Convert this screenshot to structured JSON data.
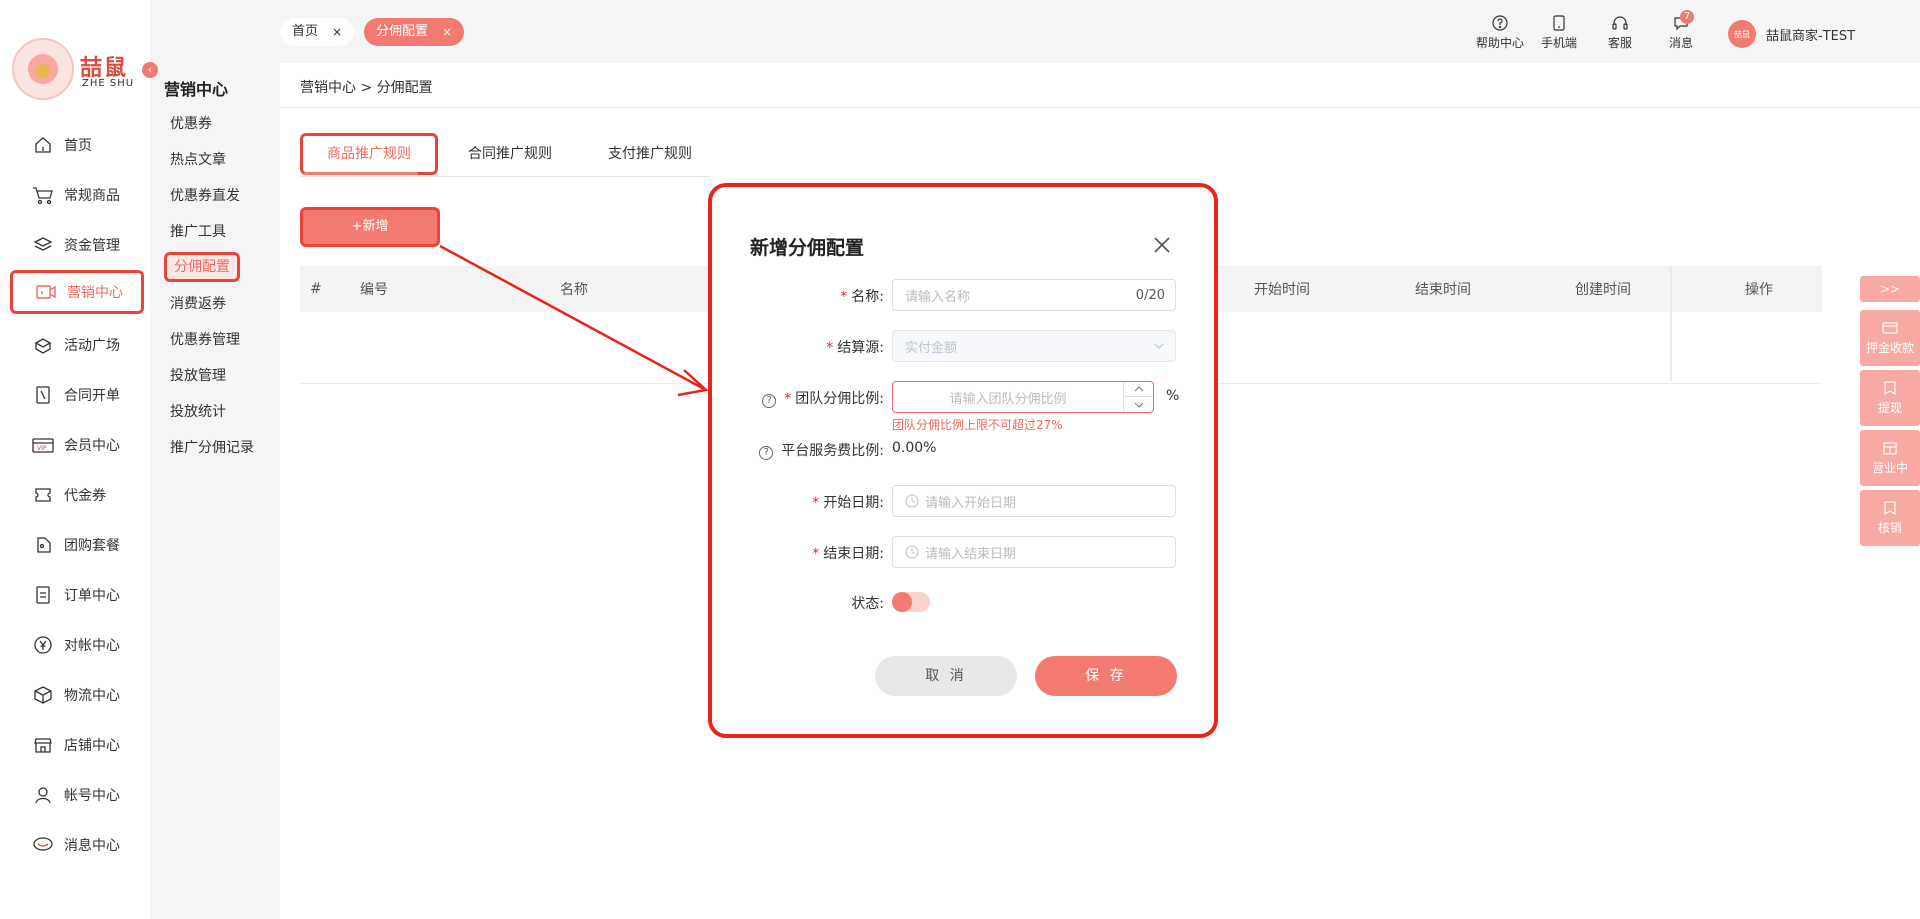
{
  "logo": {
    "brand_cn": "喆鼠",
    "brand_en": "ZHE SHU"
  },
  "collapse_icon": "‹",
  "nav": [
    {
      "label": "首页",
      "icon": "home-icon"
    },
    {
      "label": "常规商品",
      "icon": "cart-icon"
    },
    {
      "label": "资金管理",
      "icon": "layers-icon"
    },
    {
      "label": "营销中心",
      "icon": "marketing-icon",
      "active": true
    },
    {
      "label": "活动广场",
      "icon": "activity-icon"
    },
    {
      "label": "合同开单",
      "icon": "contract-icon"
    },
    {
      "label": "会员中心",
      "icon": "vip-icon"
    },
    {
      "label": "代金券",
      "icon": "voucher-icon"
    },
    {
      "label": "团购套餐",
      "icon": "groupbuy-icon"
    },
    {
      "label": "订单中心",
      "icon": "order-icon"
    },
    {
      "label": "对帐中心",
      "icon": "yen-icon"
    },
    {
      "label": "物流中心",
      "icon": "box-icon"
    },
    {
      "label": "店铺中心",
      "icon": "store-icon"
    },
    {
      "label": "帐号中心",
      "icon": "user-icon"
    },
    {
      "label": "消息中心",
      "icon": "message-icon"
    }
  ],
  "subnav": {
    "title": "营销中心",
    "items": [
      "优惠券",
      "热点文章",
      "优惠券直发",
      "推广工具",
      "分佣配置",
      "消费返券",
      "优惠券管理",
      "投放管理",
      "投放统计",
      "推广分佣记录"
    ],
    "active_index": 4
  },
  "topbar": {
    "tabs": [
      {
        "label": "首页"
      },
      {
        "label": "分佣配置"
      }
    ],
    "close_glyph": "×",
    "tools": [
      {
        "label": "帮助中心",
        "icon": "help-icon"
      },
      {
        "label": "手机端",
        "icon": "mobile-icon"
      },
      {
        "label": "客服",
        "icon": "headset-icon"
      },
      {
        "label": "消息",
        "icon": "chat-icon",
        "badge": "7"
      }
    ],
    "user_name": "喆鼠商家-TEST",
    "avatar_text": "喆鼠"
  },
  "breadcrumb": "营销中心 > 分佣配置",
  "tabs": [
    "商品推广规则",
    "合同推广规则",
    "支付推广规则"
  ],
  "add_button": "+新增",
  "table_headers": [
    "#",
    "编号",
    "名称",
    "开始时间",
    "结束时间",
    "创建时间",
    "操作"
  ],
  "right_panel": {
    "toggle": ">>",
    "items": [
      {
        "label": "押金收款",
        "icon": "card-icon"
      },
      {
        "label": "提现",
        "icon": "withdraw-icon"
      },
      {
        "label": "营业中",
        "icon": "shop-icon"
      },
      {
        "label": "核销",
        "icon": "verify-icon"
      }
    ]
  },
  "dialog": {
    "title": "新增分佣配置",
    "fields": {
      "name": {
        "label": "名称:",
        "placeholder": "请输入名称",
        "counter": "0/20"
      },
      "settle": {
        "label": "结算源:",
        "value": "实付金额"
      },
      "team_ratio": {
        "label": "团队分佣比例:",
        "placeholder": "请输入团队分佣比例",
        "unit": "%",
        "error": "团队分佣比例上限不可超过27%"
      },
      "platform_fee": {
        "label": "平台服务费比例:",
        "value": "0.00%"
      },
      "start_date": {
        "label": "开始日期:",
        "placeholder": "请输入开始日期"
      },
      "end_date": {
        "label": "结束日期:",
        "placeholder": "请输入结束日期"
      },
      "status": {
        "label": "状态:"
      }
    },
    "required_mark": "*",
    "help_mark": "?",
    "cancel": "取 消",
    "save": "保 存"
  },
  "colors": {
    "accent": "#f37a70",
    "highlight": "#e8443a",
    "error": "#f06a5f"
  }
}
